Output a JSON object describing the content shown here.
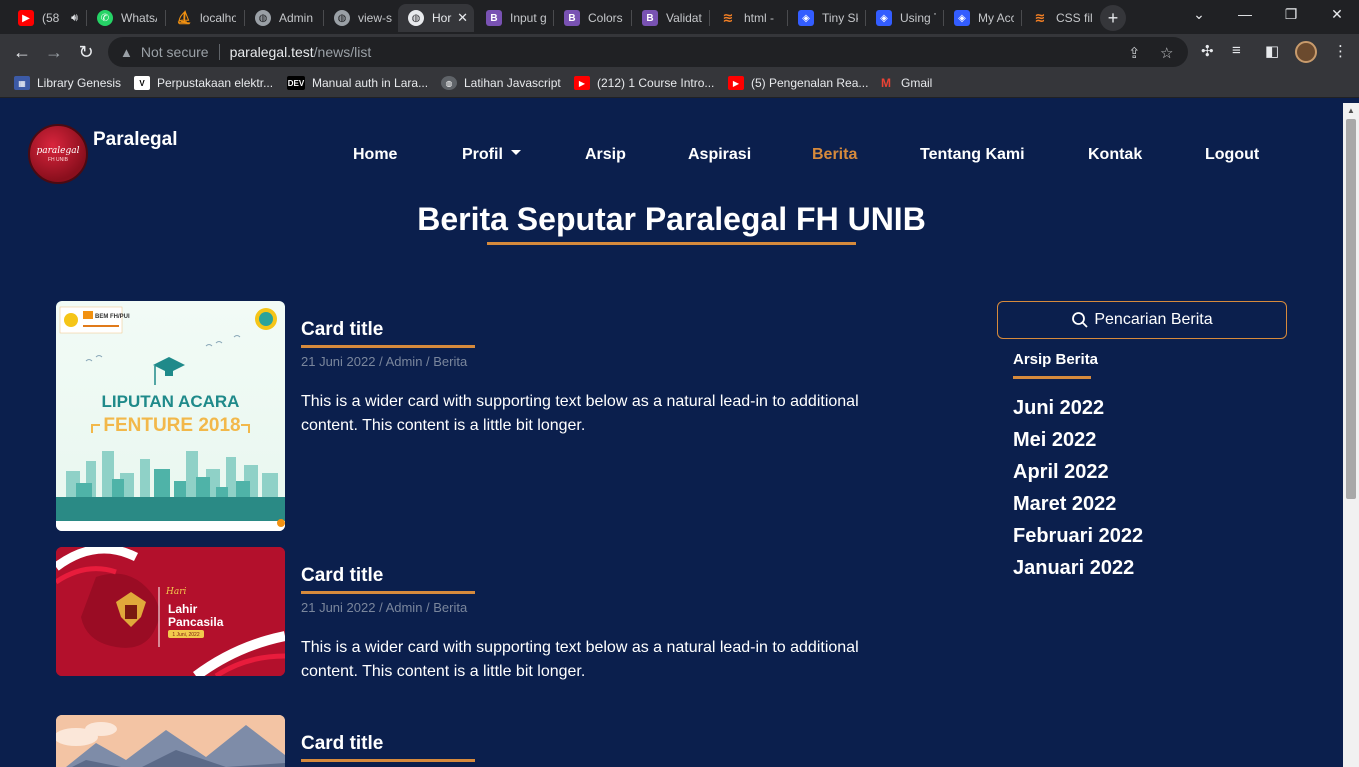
{
  "browser": {
    "tabs": [
      {
        "title": "(58",
        "favicon": "youtube-icon",
        "color": "#ff0000"
      },
      {
        "title": "WhatsA",
        "favicon": "whatsapp-icon",
        "color": "#25d366"
      },
      {
        "title": "localho",
        "favicon": "phpmyadmin-icon",
        "color": "#f29111"
      },
      {
        "title": "Admin",
        "favicon": "globe-icon",
        "color": "#9aa0a6"
      },
      {
        "title": "view-sc",
        "favicon": "globe-icon",
        "color": "#9aa0a6"
      },
      {
        "title": "Hor",
        "favicon": "globe-icon",
        "color": "#e8eaed",
        "active": true
      },
      {
        "title": "Input g",
        "favicon": "bootstrap-icon",
        "color": "#7952b3"
      },
      {
        "title": "Colors",
        "favicon": "bootstrap-icon",
        "color": "#7952b3"
      },
      {
        "title": "Validat",
        "favicon": "bootstrap-icon",
        "color": "#7952b3"
      },
      {
        "title": "html -",
        "favicon": "stackoverflow-icon",
        "color": "#f48024"
      },
      {
        "title": "Tiny Sk",
        "favicon": "tiny-icon",
        "color": "#335dff"
      },
      {
        "title": "Using T",
        "favicon": "tiny-icon",
        "color": "#335dff"
      },
      {
        "title": "My Acc",
        "favicon": "tiny-icon",
        "color": "#335dff"
      },
      {
        "title": "CSS file",
        "favicon": "stackoverflow-icon",
        "color": "#f48024"
      }
    ],
    "address": {
      "security": "Not secure",
      "host": "paralegal.test",
      "path": "/news/list"
    },
    "bookmarks": [
      {
        "label": "Library Genesis",
        "icon": "libgen-icon"
      },
      {
        "label": "Perpustakaan elektr...",
        "icon": "v-icon"
      },
      {
        "label": "Manual auth in Lara...",
        "icon": "dev-icon"
      },
      {
        "label": "Latihan Javascript",
        "icon": "globe-icon"
      },
      {
        "label": "(212) 1 Course Intro...",
        "icon": "youtube-icon"
      },
      {
        "label": "(5) Pengenalan Rea...",
        "icon": "youtube-icon"
      },
      {
        "label": "Gmail",
        "icon": "gmail-icon"
      }
    ]
  },
  "site": {
    "brand": "Paralegal",
    "logo_text": "paralegal",
    "logo_subtext": "FH UNIB",
    "nav": [
      {
        "label": "Home"
      },
      {
        "label": "Profil",
        "dropdown": true
      },
      {
        "label": "Arsip"
      },
      {
        "label": "Aspirasi"
      },
      {
        "label": "Berita",
        "active": true
      },
      {
        "label": "Tentang Kami"
      },
      {
        "label": "Kontak"
      },
      {
        "label": "Logout"
      }
    ],
    "page_title": "Berita Seputar Paralegal FH UNIB",
    "accent_color": "#d68a3c",
    "background_color": "#0b1f4d"
  },
  "news": [
    {
      "title": "Card title",
      "meta": "21 Juni 2022 / Admin / Berita",
      "text": "This is a wider card with supporting text below as a natural lead-in to additional content. This content is a little bit longer.",
      "image": {
        "heading": "LIPUTAN ACARA",
        "subheading": "FENTURE 2018",
        "badge": "BEM FH/PUI"
      }
    },
    {
      "title": "Card title",
      "meta": "21 Juni 2022 / Admin / Berita",
      "text": "This is a wider card with supporting text below as a natural lead-in to additional content. This content is a little bit longer.",
      "image": {
        "script": "Hari",
        "heading": "Lahir",
        "subheading": "Pancasila",
        "date": "1 Juni, 2022"
      }
    },
    {
      "title": "Card title",
      "image": {}
    }
  ],
  "sidebar": {
    "search_label": "Pencarian Berita",
    "archive_heading": "Arsip Berita",
    "archive": [
      "Juni 2022",
      "Mei 2022",
      "April 2022",
      "Maret 2022",
      "Februari 2022",
      "Januari 2022"
    ]
  }
}
